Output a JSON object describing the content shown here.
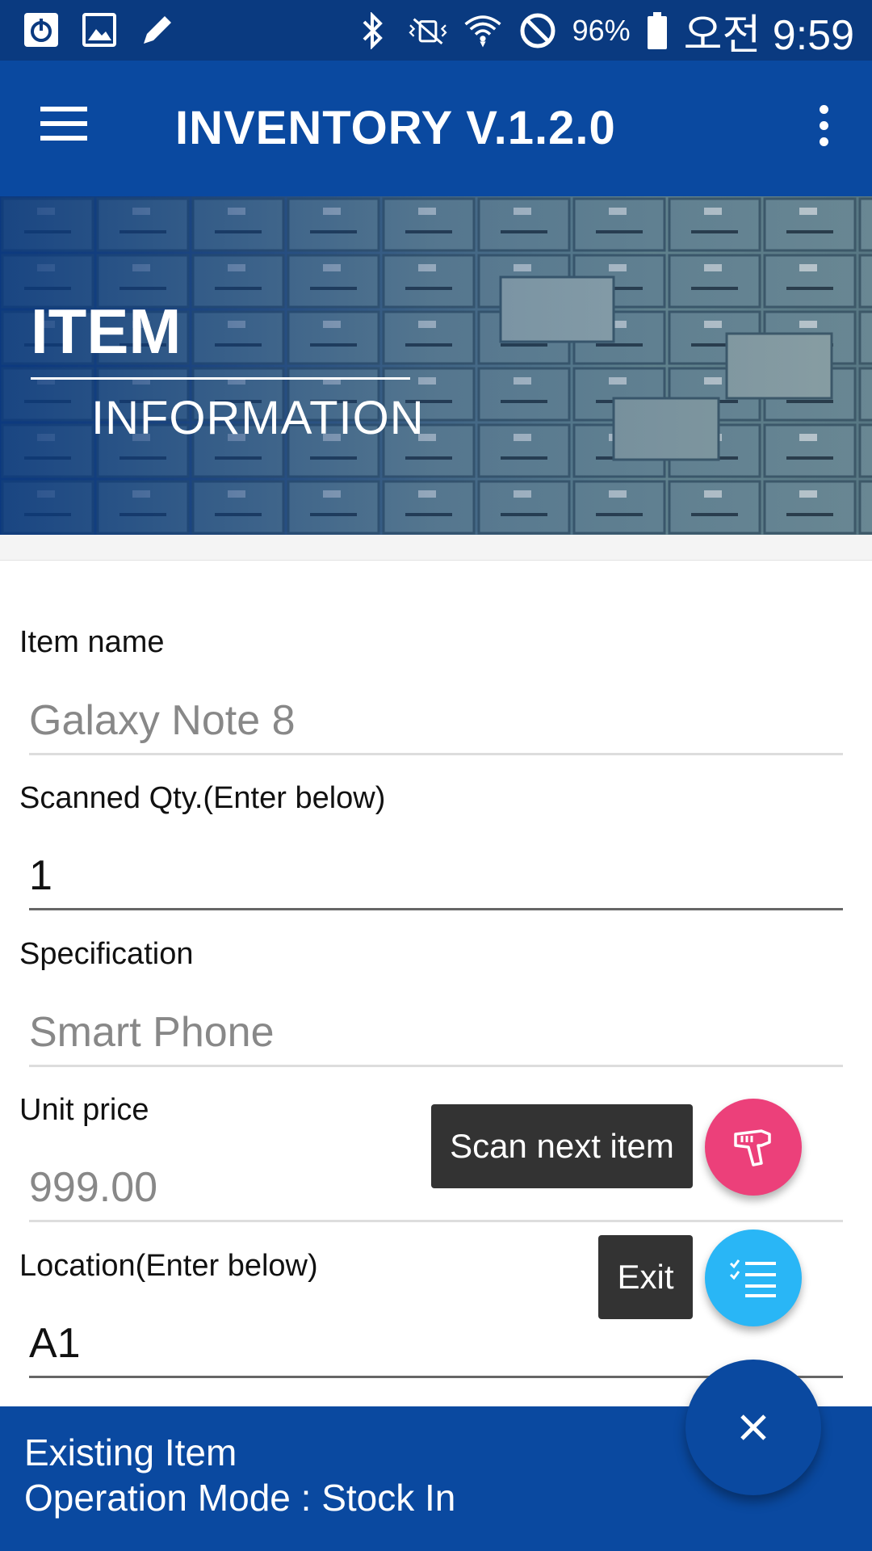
{
  "status_bar": {
    "left_icons": [
      "power-icon",
      "image-icon",
      "pencil-icon"
    ],
    "right_icons": [
      "bluetooth-icon",
      "vibrate-icon",
      "wifi-icon",
      "do-not-disturb-icon",
      "battery-icon"
    ],
    "battery_percent": "96%",
    "time": "오전 9:59"
  },
  "app_bar": {
    "title": "INVENTORY V.1.2.0",
    "menu_icon": "hamburger-menu-icon",
    "overflow_icon": "more-vert-icon"
  },
  "banner": {
    "title_main": "ITEM",
    "title_sub": "INFORMATION"
  },
  "form": {
    "item_name": {
      "label": "Item name",
      "value": "Galaxy Note 8"
    },
    "scanned_qty": {
      "label": "Scanned Qty.(Enter below)",
      "value": "1"
    },
    "specification": {
      "label": "Specification",
      "value": "Smart Phone"
    },
    "unit_price": {
      "label": "Unit price",
      "value": "999.00"
    },
    "location": {
      "label": "Location(Enter below)",
      "value": "A1"
    }
  },
  "fab_menu": {
    "scan_next_label": "Scan next item",
    "exit_label": "Exit",
    "colors": {
      "scan": "#ec407a",
      "exit": "#29b6f6",
      "main": "#0a49a0"
    }
  },
  "bottom_bar": {
    "line1": "Existing Item",
    "line2": "Operation Mode : Stock In"
  },
  "colors": {
    "primary": "#0a49a0",
    "status_bar": "#0a3a80"
  }
}
